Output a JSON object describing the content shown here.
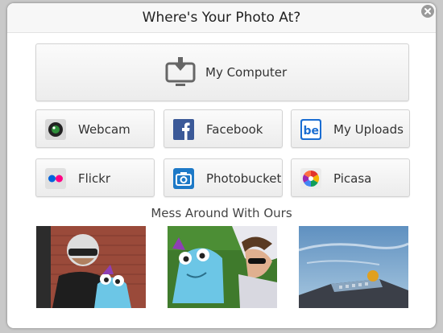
{
  "dialog": {
    "title": "Where's Your Photo At?",
    "close_icon": "close-icon"
  },
  "sources": {
    "my_computer": "My Computer",
    "webcam": "Webcam",
    "facebook": "Facebook",
    "my_uploads": "My Uploads",
    "flickr": "Flickr",
    "photobucket": "Photobucket",
    "picasa": "Picasa"
  },
  "samples": {
    "heading": "Mess Around With Ours"
  },
  "colors": {
    "facebook": "#3b5998",
    "uploads": "#1a6dd2",
    "flickr_blue": "#0063dc",
    "flickr_pink": "#ff0084"
  }
}
